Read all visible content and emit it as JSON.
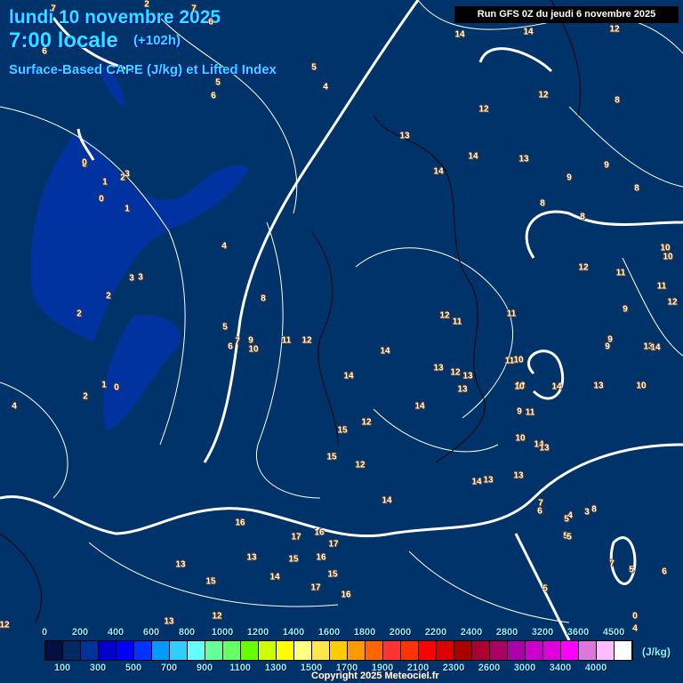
{
  "header": {
    "date": "lundi 10 novembre 2025",
    "time": "7:00 locale",
    "lead": "(+102h)",
    "parameter": "Surface-Based CAPE (J/kg) et Lifted Index",
    "run": "Run GFS 0Z du jeudi 6 novembre 2025"
  },
  "legend": {
    "top_labels": [
      "0",
      "200",
      "400",
      "600",
      "800",
      "1000",
      "1200",
      "1400",
      "1600",
      "1800",
      "2000",
      "2200",
      "2400",
      "2800",
      "3200",
      "3600",
      "4500"
    ],
    "bottom_labels": [
      "100",
      "300",
      "500",
      "700",
      "900",
      "1100",
      "1300",
      "1500",
      "1700",
      "1900",
      "2100",
      "2300",
      "2600",
      "3000",
      "3400",
      "4000"
    ],
    "colors": [
      "#001040",
      "#002a60",
      "#003399",
      "#0000cc",
      "#0000ff",
      "#0033ff",
      "#0099ff",
      "#33ccff",
      "#66ffff",
      "#66ff99",
      "#66ff66",
      "#66ff00",
      "#ccff00",
      "#ffff00",
      "#ffff80",
      "#ffe64d",
      "#ffcc00",
      "#ff9900",
      "#ff6600",
      "#ff3333",
      "#ff3300",
      "#ff0000",
      "#dd0000",
      "#aa0000",
      "#aa0033",
      "#aa0066",
      "#aa00aa",
      "#cc00cc",
      "#dd00dd",
      "#ff00ff",
      "#dd77dd",
      "#ffbbff",
      "#ffffff"
    ],
    "unit": "(J/kg)"
  },
  "copyright": "Copyright 2025 Meteociel.fr",
  "lifted_index_labels": [
    "7",
    "2",
    "7",
    "6",
    "6",
    "5",
    "6",
    "5",
    "4",
    "3",
    "0",
    "1",
    "2",
    "3",
    "0",
    "1",
    "4",
    "2",
    "3",
    "3",
    "2",
    "1",
    "0",
    "2",
    "4",
    "5",
    "6",
    "7",
    "9",
    "10",
    "11",
    "12",
    "8",
    "13",
    "14",
    "14",
    "12",
    "11",
    "12",
    "13",
    "14",
    "13",
    "12",
    "13",
    "13",
    "14",
    "12",
    "15",
    "12",
    "15",
    "14",
    "14",
    "13",
    "14",
    "13",
    "10",
    "11",
    "12",
    "13",
    "11",
    "9",
    "8",
    "8",
    "8",
    "9",
    "10",
    "11",
    "9",
    "13",
    "14",
    "10",
    "12",
    "14",
    "9",
    "10",
    "13",
    "11",
    "10",
    "7",
    "5",
    "4",
    "3",
    "5",
    "16",
    "13",
    "17",
    "16",
    "15",
    "14",
    "15",
    "17",
    "16",
    "16",
    "17",
    "13",
    "15",
    "13",
    "12",
    "12",
    "9",
    "11",
    "12",
    "13",
    "14",
    "8",
    "14",
    "14",
    "12",
    "10",
    "9",
    "8",
    "5",
    "6",
    "7",
    "6",
    "5",
    "0",
    "4",
    "5"
  ]
}
